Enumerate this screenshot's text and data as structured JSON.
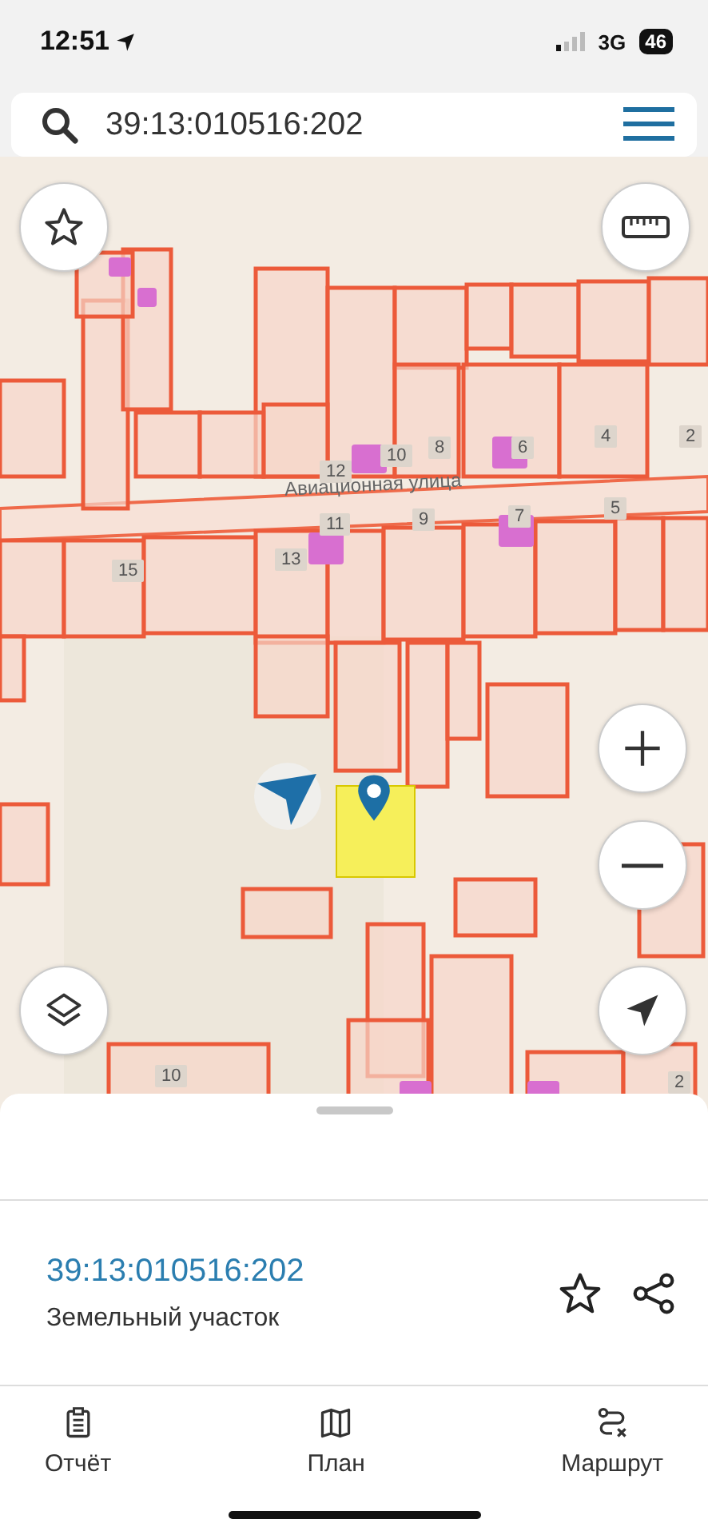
{
  "status_bar": {
    "time": "12:51",
    "network": "3G",
    "battery": "46"
  },
  "search": {
    "value": "39:13:010516:202"
  },
  "map": {
    "street": "Авиационная улица",
    "labels": [
      {
        "text": "12"
      },
      {
        "text": "10"
      },
      {
        "text": "8"
      },
      {
        "text": "6"
      },
      {
        "text": "4"
      },
      {
        "text": "2"
      },
      {
        "text": "11"
      },
      {
        "text": "9"
      },
      {
        "text": "7"
      },
      {
        "text": "5"
      },
      {
        "text": "15"
      },
      {
        "text": "13"
      },
      {
        "text": "10"
      },
      {
        "text": "2"
      }
    ]
  },
  "card": {
    "title": "39:13:010516:202",
    "subtitle": "Земельный участок"
  },
  "tabs": [
    {
      "label": "Отчёт"
    },
    {
      "label": "План"
    },
    {
      "label": "Маршрут"
    }
  ]
}
